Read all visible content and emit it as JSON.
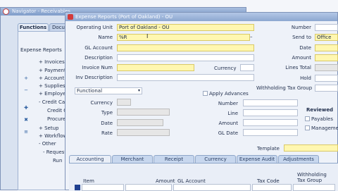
{
  "navigator": {
    "window_title": "Navigator - Receivables",
    "tabs": [
      "Functions",
      "Documents"
    ],
    "section_title": "Expense Reports",
    "tree": [
      "+ Invoices",
      "+ Payments",
      "+ Accounting",
      "+ Supplies",
      "+ Employees",
      "- Credit Cards",
      "Credit Card",
      "Procurement",
      "+ Setup",
      "+ Workflow",
      "- Other",
      "- Requests",
      "Run"
    ]
  },
  "form": {
    "title": "Expense Reports (Port of Oakland) - OU",
    "labels": {
      "operating_unit": "Operating Unit",
      "name": "Name",
      "gl_account": "GL Account",
      "description": "Description",
      "invoice_num": "Invoice Num",
      "currency": "Currency",
      "inv_description": "Inv Description",
      "number": "Number",
      "send_to": "Send to",
      "date": "Date",
      "amount": "Amount",
      "lines_total": "Lines Total",
      "hold": "Hold",
      "withholding_tax_group": "Withholding Tax Group",
      "currency2": "Currency",
      "type": "Type",
      "date2": "Date",
      "rate": "Rate",
      "apply_advances": "Apply Advances",
      "adv_number": "Number",
      "line": "Line",
      "adv_amount": "Amount",
      "gl_date": "GL Date",
      "reviewed": "Reviewed",
      "payables": "Payables",
      "management": "Management",
      "template": "Template"
    },
    "values": {
      "operating_unit": "Port of Oakland - OU",
      "name": "%R",
      "send_to": "Office",
      "functional": "Functional"
    },
    "tabs": [
      "Accounting",
      "Merchant",
      "Receipt",
      "Currency",
      "Expense Audit",
      "Adjustments"
    ],
    "table_headers": {
      "item": "Item",
      "amount": "Amount",
      "gl_account": "GL Account",
      "tax_code": "Tax Code",
      "withholding_tax_group": "Withholding Tax Group"
    }
  }
}
